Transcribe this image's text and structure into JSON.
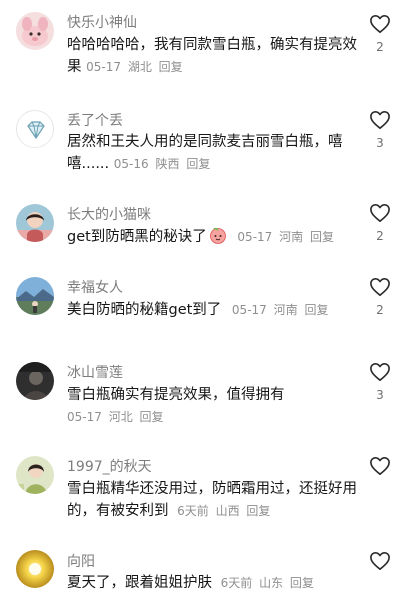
{
  "comments": [
    {
      "username": "快乐小神仙",
      "text": "哈哈哈哈哈，我有同款雪白瓶，确实有提亮效果",
      "date": "05-17",
      "location": "湖北",
      "reply": "回复",
      "likes": "2",
      "avatar_icon": "pink-animal-avatar-icon"
    },
    {
      "username": "丢了个丢",
      "text": "居然和王夫人用的是同款麦吉丽雪白瓶，嘻嘻......",
      "date": "05-16",
      "location": "陕西",
      "reply": "回复",
      "likes": "3",
      "avatar_icon": "diamond-avatar-icon"
    },
    {
      "username": "长大的小猫咪",
      "text": "get到防晒黑的秘诀了",
      "date": "05-17",
      "location": "河南",
      "reply": "回复",
      "likes": "2",
      "avatar_icon": "girl-portrait-avatar-icon",
      "emoji": "peach-face-emoji-icon"
    },
    {
      "username": "幸福女人",
      "text": "美白防晒的秘籍get到了",
      "date": "05-17",
      "location": "河南",
      "reply": "回复",
      "likes": "2",
      "avatar_icon": "landscape-avatar-icon"
    },
    {
      "username": "冰山雪莲",
      "text": "雪白瓶确实有提亮效果，值得拥有",
      "date": "05-17",
      "location": "河北",
      "reply": "回复",
      "likes": "3",
      "avatar_icon": "dark-portrait-avatar-icon"
    },
    {
      "username": "1997_的秋天",
      "text": "雪白瓶精华还没用过，防晒霜用过，还挺好用的，有被安利到",
      "date": "6天前",
      "location": "山西",
      "reply": "回复",
      "likes": "",
      "avatar_icon": "girl-green-avatar-icon"
    },
    {
      "username": "向阳",
      "text": "夏天了，跟着姐姐护肤",
      "date": "6天前",
      "location": "山东",
      "reply": "回复",
      "likes": "",
      "avatar_icon": "sunflower-avatar-icon"
    }
  ],
  "colors": {
    "username": "#7d7d7d",
    "text": "#161616",
    "meta": "#8f8f8f"
  }
}
